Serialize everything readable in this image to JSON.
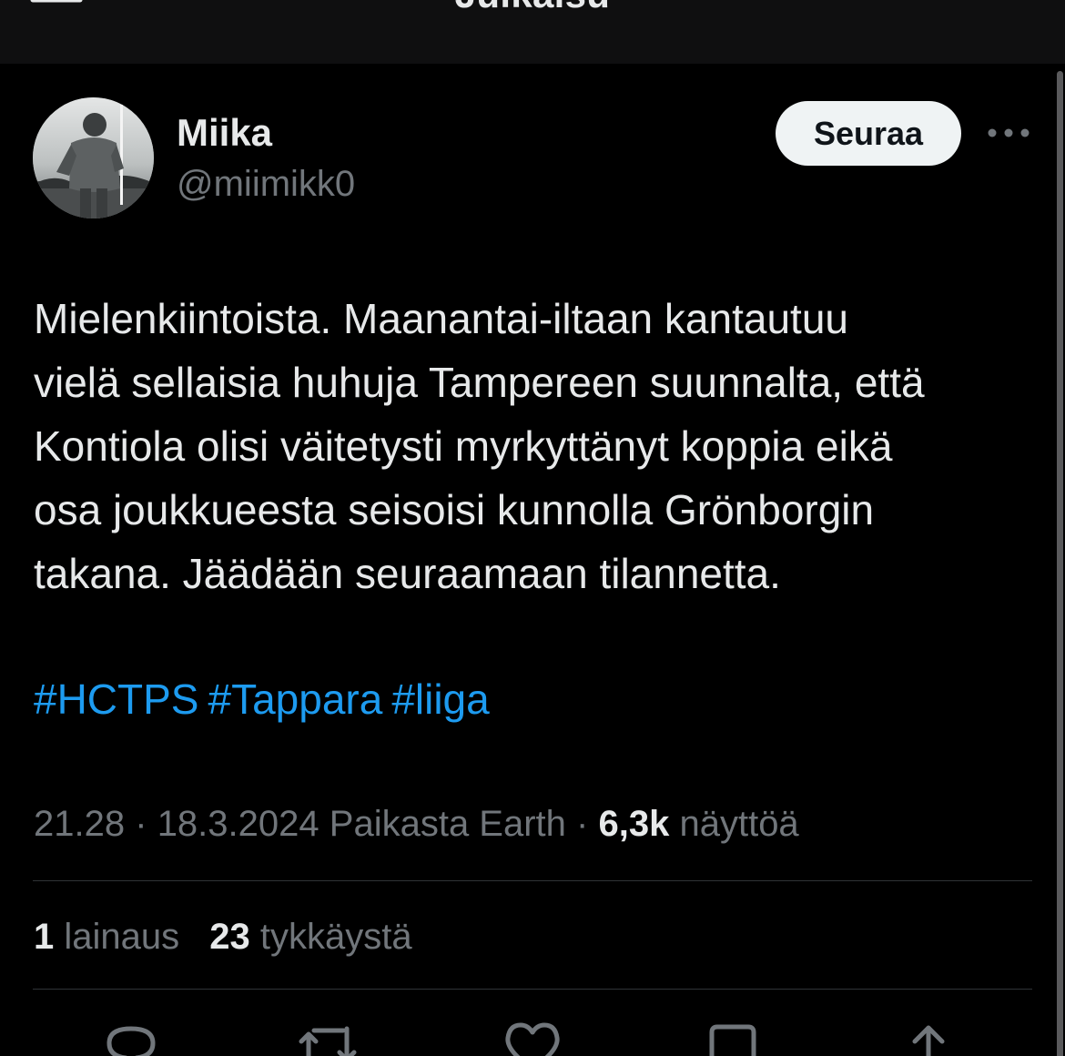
{
  "header": {
    "title": "Julkaisu",
    "back_icon": "arrow-left-icon"
  },
  "author": {
    "name": "Miika",
    "handle": "@miimikk0",
    "follow_label": "Seuraa",
    "more_icon": "more-horizontal-icon"
  },
  "tweet": {
    "text": "Mielenkiintoista. Maanantai-iltaan kantautuu\nvielä sellaisia huhuja Tampereen suunnalta, että\nKontiola olisi väitetysti myrkyttänyt koppia eikä\nosa joukkueesta seisoisi kunnolla Grönborgin\ntakana. Jäädään seuraamaan tilannetta.",
    "hashtags": [
      "#HCTPS",
      "#Tappara",
      "#liiga"
    ]
  },
  "meta": {
    "time": "21.28",
    "date": "18.3.2024",
    "location": "Paikasta Earth",
    "views_count": "6,3k",
    "views_label": "näyttöä",
    "separator": "·"
  },
  "stats": {
    "quotes_count": "1",
    "quotes_label": "lainaus",
    "likes_count": "23",
    "likes_label": "tykkäystä"
  },
  "actions": [
    "reply-icon",
    "retweet-icon",
    "like-icon",
    "bookmark-icon",
    "share-icon"
  ],
  "colors": {
    "background": "#000000",
    "text": "#e7e9ea",
    "muted": "#71767b",
    "link": "#1d9bf0",
    "divider": "#2f3336",
    "follow_bg": "#eff3f4"
  }
}
